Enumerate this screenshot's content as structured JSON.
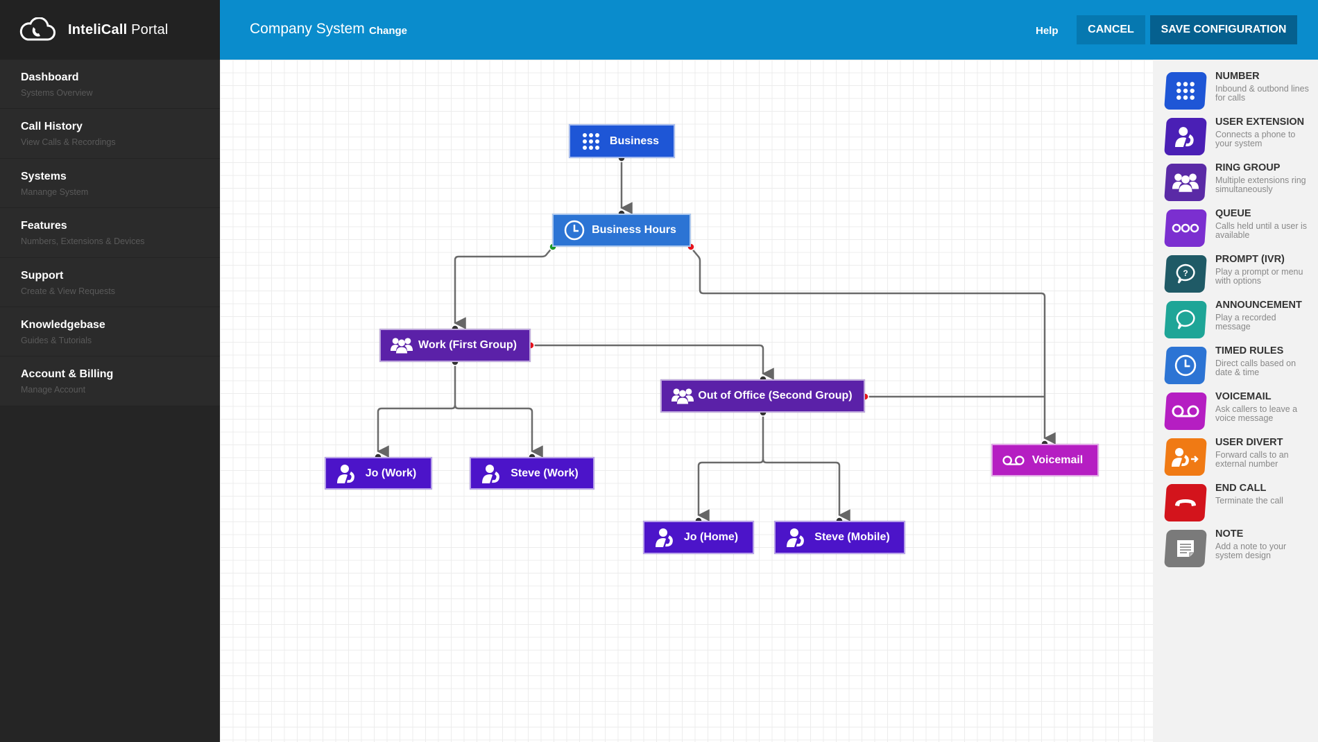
{
  "brand": {
    "name_bold": "InteliCall",
    "name_light": " Portal"
  },
  "sidebar": {
    "items": [
      {
        "title": "Dashboard",
        "subtitle": "Systems Overview"
      },
      {
        "title": "Call History",
        "subtitle": "View Calls & Recordings"
      },
      {
        "title": "Systems",
        "subtitle": "Manange System"
      },
      {
        "title": "Features",
        "subtitle": "Numbers, Extensions & Devices"
      },
      {
        "title": "Support",
        "subtitle": "Create & View Requests"
      },
      {
        "title": "Knowledgebase",
        "subtitle": "Guides & Tutorials"
      },
      {
        "title": "Account & Billing",
        "subtitle": "Manage Account"
      }
    ]
  },
  "header": {
    "system_title": "Company System",
    "change_label": "Change",
    "help_label": "Help",
    "cancel_label": "CANCEL",
    "save_label": "SAVE CONFIGURATION"
  },
  "flow": {
    "nodes": [
      {
        "id": "business",
        "label": "Business",
        "type": "number",
        "icon": "keypad-icon",
        "color": "#1e56d6"
      },
      {
        "id": "business-hours",
        "label": "Business Hours",
        "type": "timed-rules",
        "icon": "clock-icon",
        "color": "#2c74d4"
      },
      {
        "id": "work-group",
        "label": "Work (First Group)",
        "type": "ring-group",
        "icon": "group-icon",
        "color": "#5b21a8"
      },
      {
        "id": "out-of-office",
        "label": "Out of Office (Second Group)",
        "type": "ring-group",
        "icon": "group-icon",
        "color": "#5b21a8"
      },
      {
        "id": "jo-work",
        "label": "Jo (Work)",
        "type": "user-extension",
        "icon": "user-phone-icon",
        "color": "#4c14c9"
      },
      {
        "id": "steve-work",
        "label": "Steve (Work)",
        "type": "user-extension",
        "icon": "user-phone-icon",
        "color": "#4c14c9"
      },
      {
        "id": "jo-home",
        "label": "Jo (Home)",
        "type": "user-extension",
        "icon": "user-phone-icon",
        "color": "#4c14c9"
      },
      {
        "id": "steve-mobile",
        "label": "Steve (Mobile)",
        "type": "user-extension",
        "icon": "user-phone-icon",
        "color": "#4c14c9"
      },
      {
        "id": "voicemail",
        "label": "Voicemail",
        "type": "voicemail",
        "icon": "voicemail-icon",
        "color": "#b51ec2"
      }
    ],
    "connections": [
      {
        "from": "business",
        "to": "business-hours",
        "port": "default"
      },
      {
        "from": "business-hours",
        "to": "work-group",
        "port": "yes"
      },
      {
        "from": "business-hours",
        "to": "voicemail",
        "port": "no"
      },
      {
        "from": "work-group",
        "to": "jo-work",
        "port": "default"
      },
      {
        "from": "work-group",
        "to": "steve-work",
        "port": "default"
      },
      {
        "from": "work-group",
        "to": "out-of-office",
        "port": "no-answer"
      },
      {
        "from": "out-of-office",
        "to": "jo-home",
        "port": "default"
      },
      {
        "from": "out-of-office",
        "to": "steve-mobile",
        "port": "default"
      },
      {
        "from": "out-of-office",
        "to": "voicemail",
        "port": "no-answer"
      }
    ],
    "port_colors": {
      "yes": "#1a9a2a",
      "no": "#e8141c",
      "default": "#333333"
    }
  },
  "palette": {
    "items": [
      {
        "title": "NUMBER",
        "description": "Inbound & outbond lines for calls",
        "icon": "keypad-icon",
        "color": "#1e56d6"
      },
      {
        "title": "USER EXTENSION",
        "description": "Connects a phone to your system",
        "icon": "user-phone-icon",
        "color": "#4a1fb5"
      },
      {
        "title": "RING GROUP",
        "description": "Multiple extensions ring simultaneously",
        "icon": "group-icon",
        "color": "#5a2aa6"
      },
      {
        "title": "QUEUE",
        "description": "Calls held until a user is available",
        "icon": "queue-dots-icon",
        "color": "#7b2fd0"
      },
      {
        "title": "PROMPT (IVR)",
        "description": "Play a prompt or menu with options",
        "icon": "question-bubble-icon",
        "color": "#1f5a66"
      },
      {
        "title": "ANNOUNCEMENT",
        "description": "Play a recorded message",
        "icon": "speech-bubble-icon",
        "color": "#1ea597"
      },
      {
        "title": "TIMED RULES",
        "description": "Direct calls based on date & time",
        "icon": "clock-icon",
        "color": "#2c74d4"
      },
      {
        "title": "VOICEMAIL",
        "description": "Ask callers to leave a voice message",
        "icon": "voicemail-icon",
        "color": "#b51ec2"
      },
      {
        "title": "USER DIVERT",
        "description": "Forward calls to an external number",
        "icon": "user-divert-icon",
        "color": "#f07a14"
      },
      {
        "title": "END CALL",
        "description": "Terminate the call",
        "icon": "hangup-icon",
        "color": "#d3141c"
      },
      {
        "title": "NOTE",
        "description": "Add a note to your system design",
        "icon": "note-icon",
        "color": "#7a7a7a"
      }
    ]
  }
}
